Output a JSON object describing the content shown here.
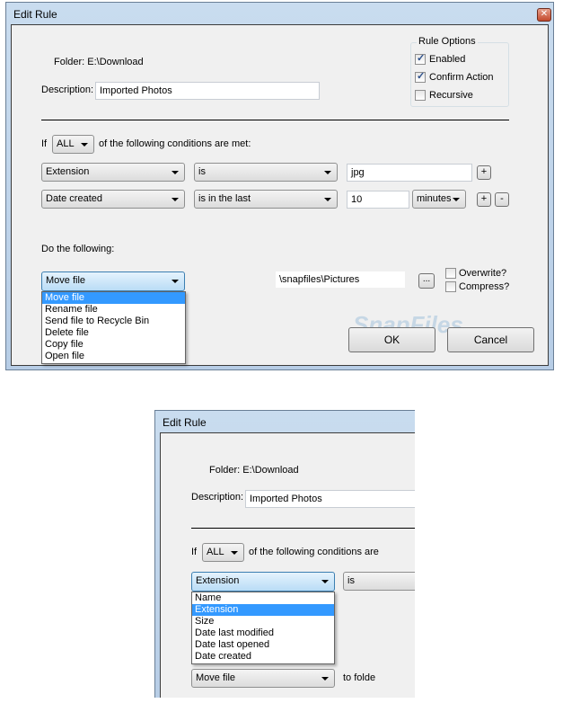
{
  "dialog1": {
    "title": "Edit Rule",
    "folder_label": "Folder: E:\\Download",
    "description_label": "Description:",
    "description_value": "Imported Photos",
    "rule_options": {
      "title": "Rule Options",
      "enabled": {
        "label": "Enabled",
        "checked": true
      },
      "confirm": {
        "label": "Confirm Action",
        "checked": true
      },
      "recursive": {
        "label": "Recursive",
        "checked": false
      }
    },
    "if_label": "If",
    "match_value": "ALL",
    "conditions_label": "of the following conditions are met:",
    "conditions": [
      {
        "field": "Extension",
        "operator": "is",
        "value": "jpg"
      },
      {
        "field": "Date created",
        "operator": "is in the last",
        "value": "10",
        "unit": "minutes"
      }
    ],
    "plus": "+",
    "minus": "-",
    "do_label": "Do the following:",
    "action_value": "Move file",
    "action_options": [
      "Move file",
      "Rename file",
      "Send file to Recycle Bin",
      "Delete file",
      "Copy file",
      "Open file"
    ],
    "target_path": "\\snapfiles\\Pictures",
    "browse": "...",
    "overwrite": {
      "label": "Overwrite?",
      "checked": false
    },
    "compress": {
      "label": "Compress?",
      "checked": false
    },
    "ok": "OK",
    "cancel": "Cancel",
    "watermark": "SnapFiles"
  },
  "dialog2": {
    "title": "Edit Rule",
    "folder_label": "Folder: E:\\Download",
    "description_label": "Description:",
    "description_value": "Imported Photos",
    "if_label": "If",
    "match_value": "ALL",
    "conditions_label": "of the following conditions are",
    "field_value": "Extension",
    "operator_value": "is",
    "field_options": [
      "Name",
      "Extension",
      "Size",
      "Date last modified",
      "Date last opened",
      "Date created"
    ],
    "action_value": "Move file",
    "to_folder_label": "to folde"
  }
}
